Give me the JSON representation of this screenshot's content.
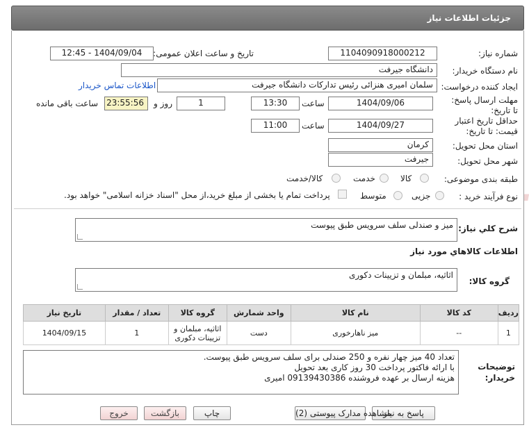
{
  "header": {
    "title": "جزئیات اطلاعات نیاز"
  },
  "labels": {
    "need_number": "شماره نیاز:",
    "announce_datetime": "تاریخ و ساعت اعلان عمومی:",
    "buyer_org": "نام دستگاه خریدار:",
    "requester": "ایجاد کننده درخواست:",
    "reply_deadline": "مهلت ارسال پاسخ: تا تاریخ:",
    "hour": "ساعت",
    "day_and": "روز و",
    "time_left": "ساعت باقی مانده",
    "price_validity": "حداقل تاریخ اعتبار قیمت: تا تاریخ:",
    "delivery_province": "استان محل تحویل:",
    "delivery_city": "شهر محل تحویل:",
    "subject_class": "طبقه بندی موضوعی:",
    "purchase_type": "نوع فرآیند خرید :",
    "need_summary": "شرح کلي نياز:",
    "goods_info": "اطلاعات کالاهاي مورد نياز",
    "goods_group": "گروه کالا:",
    "buyer_notes": "توضیحات خریدار:"
  },
  "values": {
    "need_number": "1104090918000212",
    "announce_datetime": "1404/09/04 - 12:45",
    "buyer_org": "دانشگاه جیرفت",
    "requester": "سلمان امیری هنزائی رئیس تدارکات دانشگاه جیرفت",
    "contact_link": "اطلاعات تماس خریدار",
    "reply_date": "1404/09/06",
    "reply_time": "13:30",
    "days_left": "1",
    "time_left": "23:55:56",
    "validity_date": "1404/09/27",
    "validity_time": "11:00",
    "province": "کرمان",
    "city": "جیرفت",
    "need_summary": "میز و صندلی سلف سرویس طبق پیوست",
    "goods_group": "اثاثیه، مبلمان و تزیینات دکوری"
  },
  "subject_options": [
    "کالا",
    "خدمت",
    "کالا/خدمت"
  ],
  "purchase_options": [
    "جزیی",
    "متوسط"
  ],
  "purchase_note": "پرداخت تمام یا بخشی از مبلغ خرید،از محل \"اسناد خزانه اسلامی\" خواهد بود.",
  "table": {
    "headers": [
      "ردیف",
      "کد کالا",
      "نام کالا",
      "واحد شمارش",
      "گروه کالا",
      "تعداد / مقدار",
      "تاریخ نیاز"
    ],
    "rows": [
      {
        "row": "1",
        "code": "--",
        "name": "میز ناهارخوری",
        "unit": "دست",
        "group": "اثاثیه، مبلمان و تزیینات دکوری",
        "qty": "1",
        "date": "1404/09/15"
      }
    ]
  },
  "notes_lines": [
    "تعداد 40 میز چهار نفره و 250 صندلی برای سلف سرویس طبق پیوست.",
    "با ارائه فاکتور پرداخت 30 روز کاری بعد تحویل",
    "هزینه ارسال بر عهده فروشنده 09139430386 امیری"
  ],
  "buttons": {
    "reply": "پاسخ به نیاز",
    "attachments": "مشاهده مدارک پیوستی (2)",
    "print": "چاپ",
    "back": "بازگشت",
    "exit": "خروج"
  },
  "watermark": "AriaTender.net",
  "colors": {
    "header_bg": "#7a7a7a",
    "link": "#1a56c8",
    "highlight_field": "#f8f4c4",
    "watermark": "#e8b4b4"
  }
}
